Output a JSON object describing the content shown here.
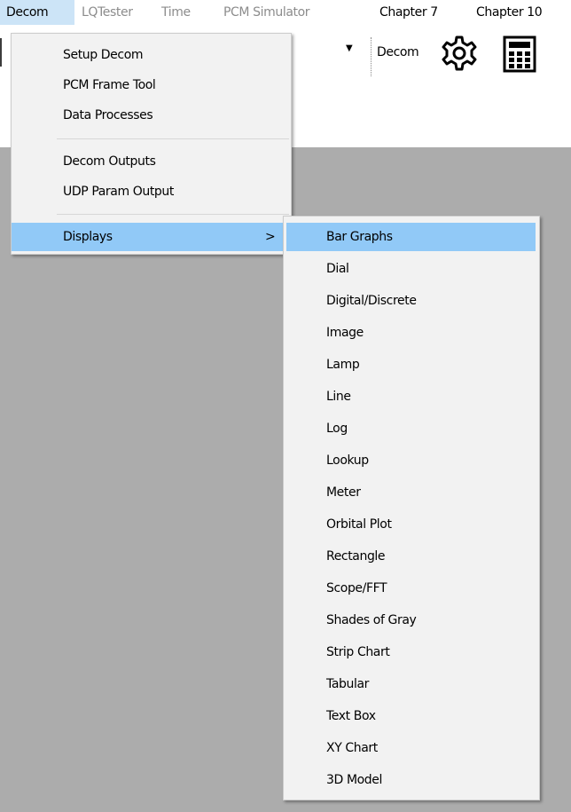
{
  "menubar": {
    "items": [
      {
        "label": "Decom",
        "state": "active"
      },
      {
        "label": "LQTester",
        "state": "disabled"
      },
      {
        "label": "Time",
        "state": "disabled"
      },
      {
        "label": "PCM Simulator",
        "state": "disabled"
      },
      {
        "label": "Chapter 7",
        "state": "normal"
      },
      {
        "label": "Chapter 10",
        "state": "normal"
      }
    ]
  },
  "toolbar": {
    "decom_label": "Decom",
    "gear_icon": "gear-icon",
    "calculator_icon": "calculator-icon"
  },
  "decom_menu": {
    "items": [
      {
        "label": "Setup Decom"
      },
      {
        "label": "PCM Frame Tool"
      },
      {
        "label": "Data Processes"
      },
      {
        "label": "Decom Outputs"
      },
      {
        "label": "UDP Param Output"
      },
      {
        "label": "Displays",
        "submenu_arrow": ">"
      }
    ]
  },
  "displays_submenu": {
    "items": [
      {
        "label": "Bar Graphs"
      },
      {
        "label": "Dial"
      },
      {
        "label": "Digital/Discrete"
      },
      {
        "label": "Image"
      },
      {
        "label": "Lamp"
      },
      {
        "label": "Line"
      },
      {
        "label": "Log"
      },
      {
        "label": "Lookup"
      },
      {
        "label": "Meter"
      },
      {
        "label": "Orbital Plot"
      },
      {
        "label": "Rectangle"
      },
      {
        "label": "Scope/FFT"
      },
      {
        "label": "Shades of Gray"
      },
      {
        "label": "Strip Chart"
      },
      {
        "label": "Tabular"
      },
      {
        "label": "Text Box"
      },
      {
        "label": "XY Chart"
      },
      {
        "label": "3D Model"
      }
    ]
  },
  "colors": {
    "menu_active": "#cce4f7",
    "highlight": "#91c9f7",
    "menu_bg": "#f2f2f2",
    "workspace": "#acacac",
    "disabled_text": "#8c8c8c"
  }
}
